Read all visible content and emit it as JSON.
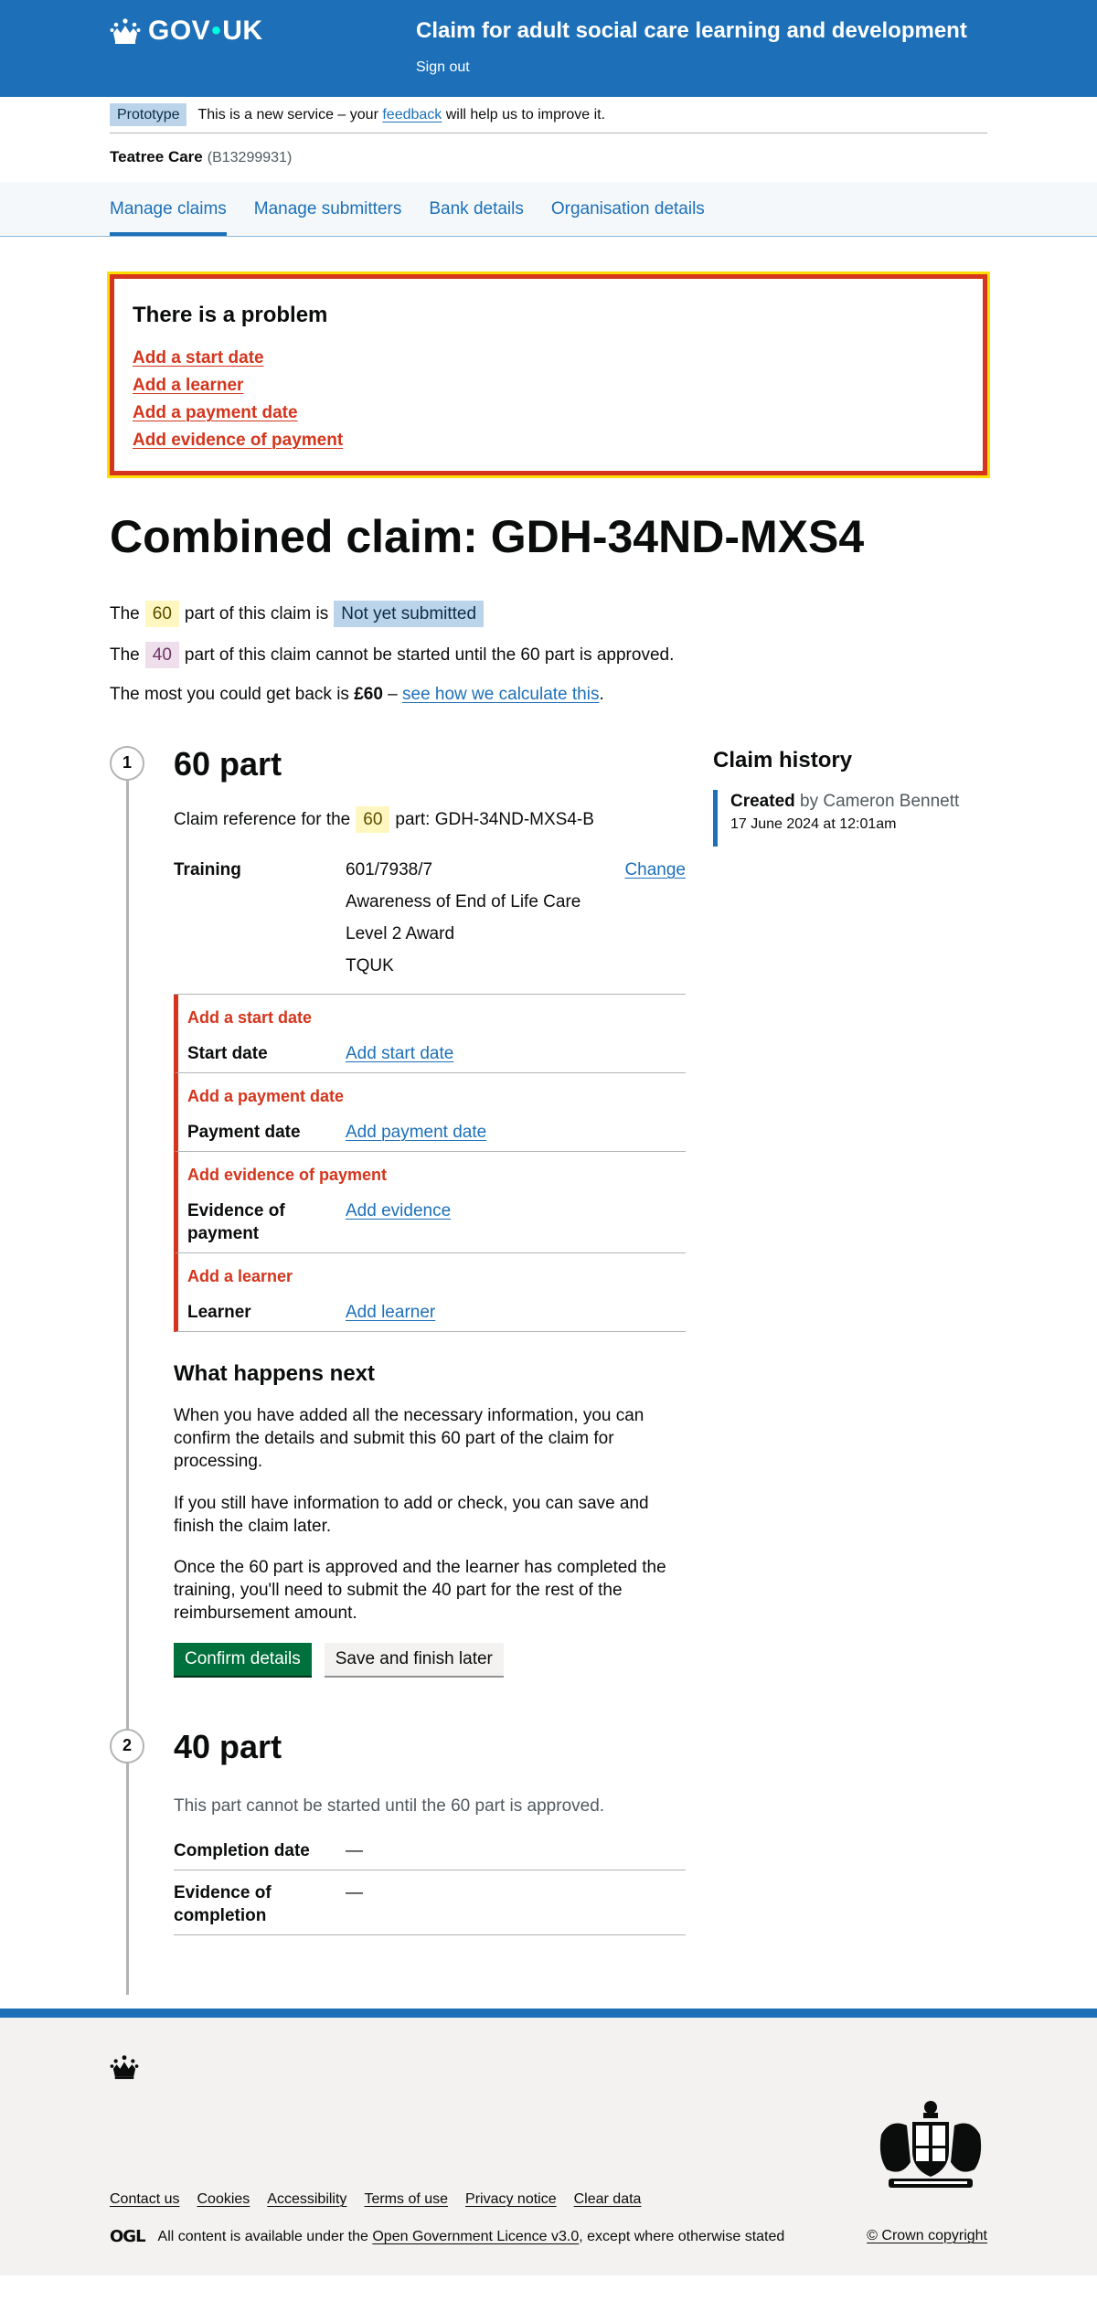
{
  "header": {
    "logo_text_1": "GOV",
    "logo_dot": "•",
    "logo_text_2": "UK",
    "service_name": "Claim for adult social care learning and development",
    "sign_out": "Sign out"
  },
  "phase_banner": {
    "tag": "Prototype",
    "text_before": "This is a new service – your ",
    "link": "feedback",
    "text_after": " will help us to improve it."
  },
  "organisation": {
    "name": "Teatree Care",
    "id": "(B13299931)"
  },
  "nav": {
    "items": [
      {
        "label": "Manage claims",
        "active": true
      },
      {
        "label": "Manage submitters"
      },
      {
        "label": "Bank details"
      },
      {
        "label": "Organisation details"
      }
    ]
  },
  "error_summary": {
    "title": "There is a problem",
    "errors": [
      "Add a start date",
      "Add a learner",
      "Add a payment date",
      "Add evidence of payment"
    ]
  },
  "page_title": "Combined claim: GDH-34ND-MXS4",
  "status": {
    "line1_before": "The",
    "line1_chip": "60",
    "line1_mid": "part of this claim is",
    "line1_status": "Not yet submitted",
    "line2_before": "The",
    "line2_chip": "40",
    "line2_after": "part of this claim cannot be started until the 60 part is approved.",
    "line3_before": "The most you could get back is ",
    "line3_amount": "£60",
    "line3_dash": " – ",
    "line3_link": "see how we calculate this",
    "line3_end": "."
  },
  "part60": {
    "number": "1",
    "title": "60 part",
    "ref_before": "Claim reference for the",
    "ref_chip": "60",
    "ref_after": "part: GDH-34ND-MXS4-B",
    "training_key": "Training",
    "training_lines": [
      "601/7938/7",
      "Awareness of End of Life Care",
      "Level 2 Award",
      "TQUK"
    ],
    "change": "Change",
    "rows": [
      {
        "error": "Add a start date",
        "key": "Start date",
        "action": "Add start date"
      },
      {
        "error": "Add a payment date",
        "key": "Payment date",
        "action": "Add payment date"
      },
      {
        "error": "Add evidence of payment",
        "key": "Evidence of payment",
        "action": "Add evidence"
      },
      {
        "error": "Add a learner",
        "key": "Learner",
        "action": "Add learner"
      }
    ],
    "next_title": "What happens next",
    "paras": [
      "When you have added all the necessary information, you can confirm the details and submit this 60 part of the claim for processing.",
      "If you still have information to add or check, you can save and finish the claim later.",
      "Once the 60 part is approved and the learner has completed the training, you'll need to submit the 40 part for the rest of the reimbursement amount."
    ],
    "confirm_button": "Confirm details",
    "save_button": "Save and finish later"
  },
  "part40": {
    "number": "2",
    "title": "40 part",
    "note": "This part cannot be started until the 60 part is approved.",
    "rows": [
      {
        "key": "Completion date",
        "value": "—"
      },
      {
        "key": "Evidence of completion",
        "value": "—"
      }
    ]
  },
  "history": {
    "title": "Claim history",
    "event": "Created",
    "by": " by Cameron Bennett",
    "date": "17 June 2024 at 12:01am"
  },
  "footer": {
    "links": [
      "Contact us",
      "Cookies",
      "Accessibility",
      "Terms of use",
      "Privacy notice",
      "Clear data"
    ],
    "ogl": "OGL",
    "licence_before": "All content is available under the ",
    "licence_link": "Open Government Licence v3.0",
    "licence_after": ", except where otherwise stated",
    "copyright": "© Crown copyright"
  },
  "colors": {
    "brand": "#1d70b8",
    "error": "#d4351c",
    "focus": "#ffdd00",
    "success": "#00703c"
  }
}
